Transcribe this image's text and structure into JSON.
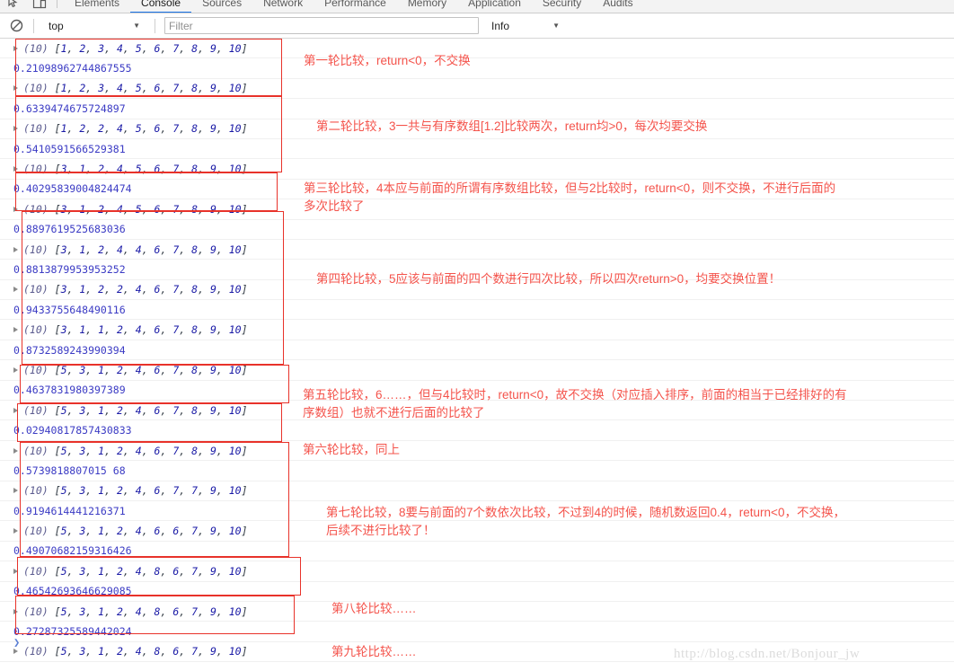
{
  "window": {
    "app": "Chrome DevTools",
    "panel": "Console"
  },
  "tabs": [
    {
      "label": "Elements",
      "active": false
    },
    {
      "label": "Console",
      "active": true
    },
    {
      "label": "Sources",
      "active": false
    },
    {
      "label": "Network",
      "active": false
    },
    {
      "label": "Performance",
      "active": false
    },
    {
      "label": "Memory",
      "active": false
    },
    {
      "label": "Application",
      "active": false
    },
    {
      "label": "Security",
      "active": false
    },
    {
      "label": "Audits",
      "active": false
    }
  ],
  "toolbar": {
    "inspect_icon": "inspect-element-icon",
    "device_icon": "device-toolbar-icon",
    "clear_icon": "clear-console-icon",
    "context_value": "top",
    "context_caret": "▼",
    "filter_placeholder": "Filter",
    "filter_value": "",
    "level_value": "Info",
    "level_caret": "▼"
  },
  "console": {
    "array_prefix": "(10)",
    "messages": [
      {
        "type": "array",
        "values": [
          1,
          2,
          3,
          4,
          5,
          6,
          7,
          8,
          9,
          10
        ]
      },
      {
        "type": "number",
        "value": "0.21098962744867555"
      },
      {
        "type": "array",
        "values": [
          1,
          2,
          3,
          4,
          5,
          6,
          7,
          8,
          9,
          10
        ]
      },
      {
        "type": "number",
        "value": "0.6339474675724897"
      },
      {
        "type": "array",
        "values": [
          1,
          2,
          2,
          4,
          5,
          6,
          7,
          8,
          9,
          10
        ]
      },
      {
        "type": "number",
        "value": "0.5410591566529381"
      },
      {
        "type": "array",
        "values": [
          3,
          1,
          2,
          4,
          5,
          6,
          7,
          8,
          9,
          10
        ]
      },
      {
        "type": "number",
        "value": "0.40295839004824474"
      },
      {
        "type": "array",
        "values": [
          3,
          1,
          2,
          4,
          5,
          6,
          7,
          8,
          9,
          10
        ]
      },
      {
        "type": "number",
        "value": "0.8897619525683036"
      },
      {
        "type": "array",
        "values": [
          3,
          1,
          2,
          4,
          4,
          6,
          7,
          8,
          9,
          10
        ]
      },
      {
        "type": "number",
        "value": "0.8813879953953252"
      },
      {
        "type": "array",
        "values": [
          3,
          1,
          2,
          2,
          4,
          6,
          7,
          8,
          9,
          10
        ]
      },
      {
        "type": "number",
        "value": "0.9433755648490116"
      },
      {
        "type": "array",
        "values": [
          3,
          1,
          1,
          2,
          4,
          6,
          7,
          8,
          9,
          10
        ]
      },
      {
        "type": "number",
        "value": "0.8732589243990394"
      },
      {
        "type": "array",
        "values": [
          5,
          3,
          1,
          2,
          4,
          6,
          7,
          8,
          9,
          10
        ]
      },
      {
        "type": "number",
        "value": "0.4637831980397389"
      },
      {
        "type": "array",
        "values": [
          5,
          3,
          1,
          2,
          4,
          6,
          7,
          8,
          9,
          10
        ]
      },
      {
        "type": "number",
        "value": "0.02940817857430833"
      },
      {
        "type": "array",
        "values": [
          5,
          3,
          1,
          2,
          4,
          6,
          7,
          8,
          9,
          10
        ]
      },
      {
        "type": "number",
        "value": "0.5739818807015 68"
      },
      {
        "type": "array",
        "values": [
          5,
          3,
          1,
          2,
          4,
          6,
          7,
          7,
          9,
          10
        ]
      },
      {
        "type": "number",
        "value": "0.9194614441216371"
      },
      {
        "type": "array",
        "values": [
          5,
          3,
          1,
          2,
          4,
          6,
          6,
          7,
          9,
          10
        ]
      },
      {
        "type": "number",
        "value": "0.49070682159316426"
      },
      {
        "type": "array",
        "values": [
          5,
          3,
          1,
          2,
          4,
          8,
          6,
          7,
          9,
          10
        ]
      },
      {
        "type": "number",
        "value": "0.46542693646629085"
      },
      {
        "type": "array",
        "values": [
          5,
          3,
          1,
          2,
          4,
          8,
          6,
          7,
          9,
          10
        ]
      },
      {
        "type": "number",
        "value": "0.27287325589442024"
      },
      {
        "type": "array",
        "values": [
          5,
          3,
          1,
          2,
          4,
          8,
          6,
          7,
          9,
          10
        ]
      }
    ],
    "prompt_symbol": "❯"
  },
  "annotations": {
    "accent_color": "#f4534b",
    "box_color": "#e8322a",
    "notes": [
      {
        "id": "round-1",
        "text": "第一轮比较，return<0，不交换"
      },
      {
        "id": "round-2",
        "text": "第二轮比较，3一共与有序数组[1.2]比较两次，return均>0，每次均要交换"
      },
      {
        "id": "round-3",
        "text": "第三轮比较，4本应与前面的所谓有序数组比较，但与2比较时，return<0，则不交换，不进行后面的\n多次比较了"
      },
      {
        "id": "round-4",
        "text": "第四轮比较，5应该与前面的四个数进行四次比较，所以四次return>0，均要交换位置！"
      },
      {
        "id": "round-5",
        "text": "第五轮比较，6……，但与4比较时，return<0，故不交换（对应插入排序，前面的相当于已经排好的有\n序数组）也就不进行后面的比较了"
      },
      {
        "id": "round-6",
        "text": "第六轮比较，同上"
      },
      {
        "id": "round-7",
        "text": "第七轮比较，8要与前面的7个数依次比较，不过到4的时候，随机数返回0.4，return<0，不交换，\n后续不进行比较了！"
      },
      {
        "id": "round-8",
        "text": "第八轮比较……"
      },
      {
        "id": "round-9",
        "text": "第九轮比较……"
      }
    ]
  },
  "watermark": {
    "text": "http://blog.csdn.net/Bonjour_jw"
  }
}
